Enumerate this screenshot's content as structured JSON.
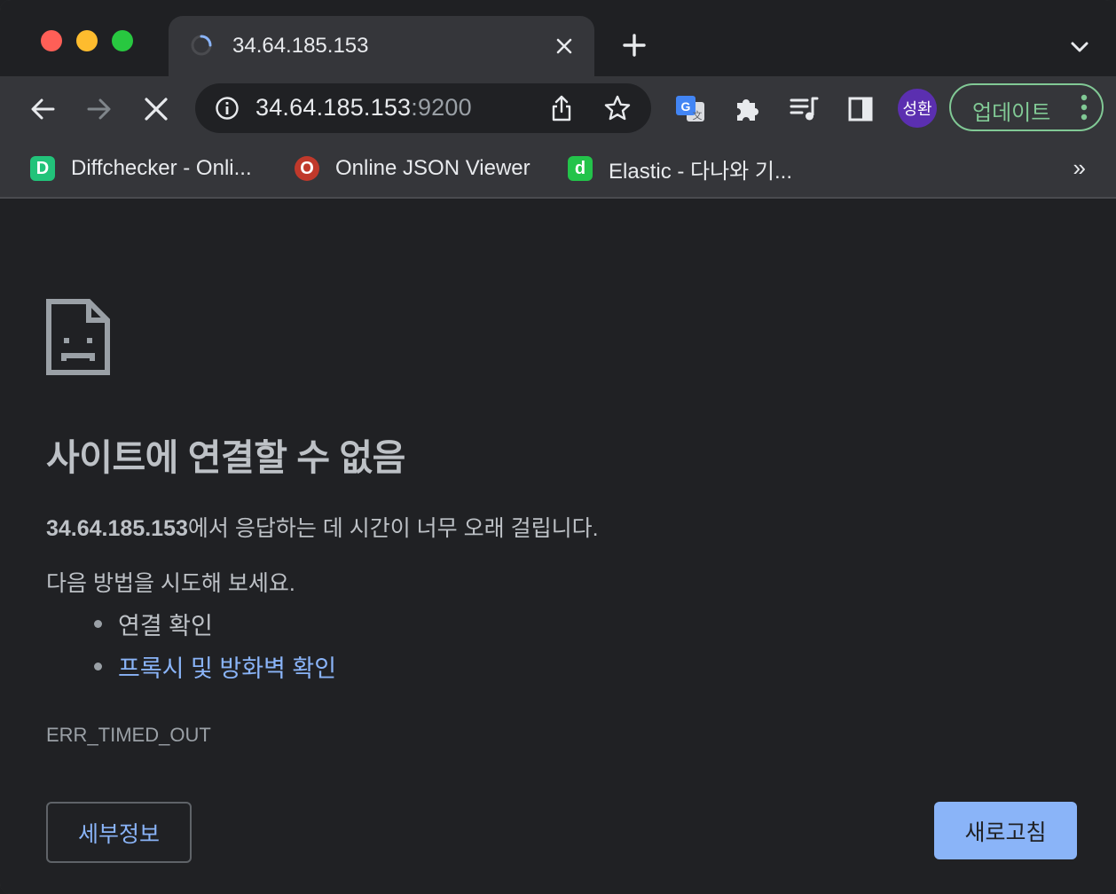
{
  "tab": {
    "title": "34.64.185.153"
  },
  "omnibox": {
    "host": "34.64.185.153",
    "port": ":9200"
  },
  "profile": {
    "avatar_text": "성환"
  },
  "toolbar": {
    "update_label": "업데이트"
  },
  "bookmarks": [
    {
      "label": "Diffchecker - Onli...",
      "icon": "D",
      "icon_color": "#22c37a"
    },
    {
      "label": "Online JSON Viewer",
      "icon": "O",
      "icon_color": "#c0392b"
    },
    {
      "label": "Elastic - 다나와 기...",
      "icon": "d",
      "icon_color": "#23c34a"
    }
  ],
  "bookmarks_overflow": "»",
  "error": {
    "title": "사이트에 연결할 수 없음",
    "host_bold": "34.64.185.153",
    "desc_rest": "에서 응답하는 데 시간이 너무 오래 걸립니다.",
    "try_text": "다음 방법을 시도해 보세요.",
    "suggestions": [
      "연결 확인",
      "프록시 및 방화벽 확인"
    ],
    "code": "ERR_TIMED_OUT",
    "details_label": "세부정보",
    "reload_label": "새로고침"
  },
  "colors": {
    "accent": "#8ab4f8",
    "update_green": "#81c995",
    "background": "#202124"
  }
}
